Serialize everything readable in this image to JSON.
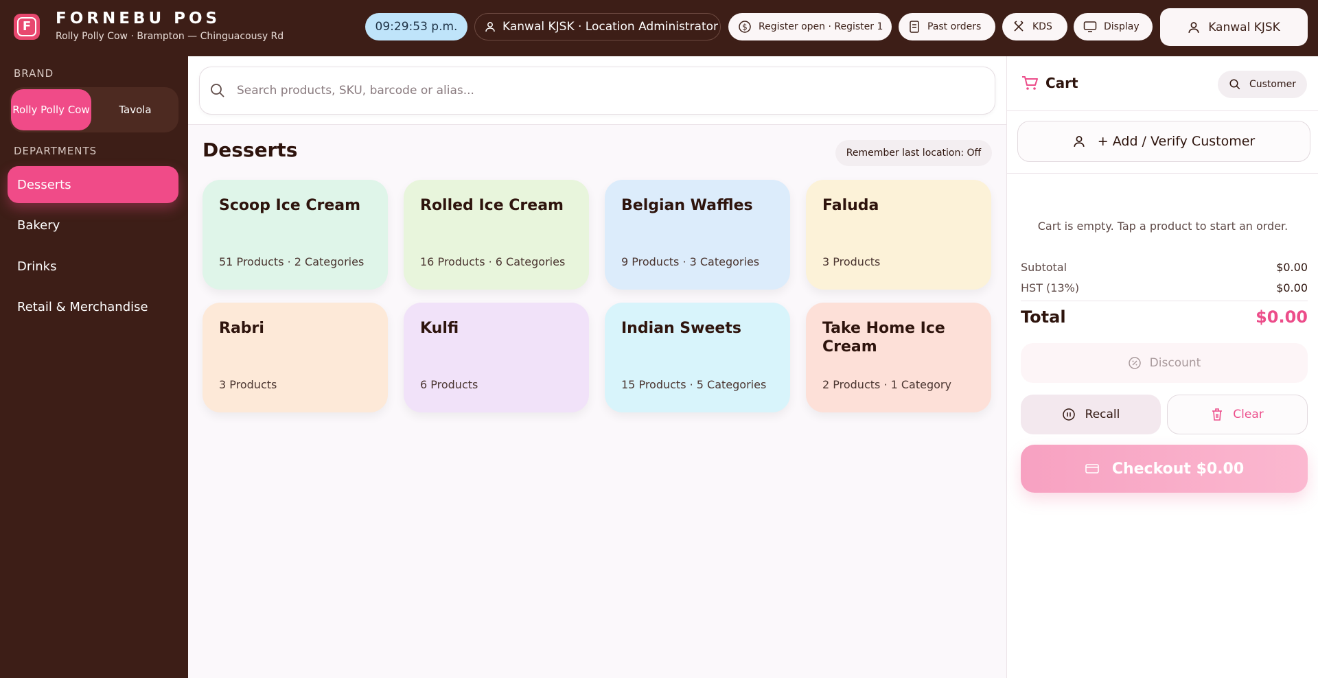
{
  "header": {
    "logo_letter": "F",
    "app_title": "FORNEBU POS",
    "location": "Rolly Polly Cow · Brampton — Chinguacousy Rd",
    "clock": "09:29:53 p.m.",
    "user_role": "Kanwal KJSK · Location Administrator",
    "register": "Register open · Register 1",
    "past_orders": "Past orders",
    "kds": "KDS",
    "display": "Display",
    "account": "Kanwal KJSK"
  },
  "sidebar": {
    "brand_label": "BRAND",
    "brands": [
      "Rolly Polly Cow",
      "Tavola"
    ],
    "departments_label": "DEPARTMENTS",
    "departments": [
      "Desserts",
      "Bakery",
      "Drinks",
      "Retail & Merchandise"
    ],
    "active_department": "Desserts"
  },
  "main": {
    "search_placeholder": "Search products, SKU, barcode or alias...",
    "section_title": "Desserts",
    "remember_label": "Remember last location: Off",
    "cards": [
      {
        "title": "Scoop Ice Cream",
        "meta": "51 Products · 2 Categories",
        "color": "#dff5e9"
      },
      {
        "title": "Rolled Ice Cream",
        "meta": "16 Products · 6 Categories",
        "color": "#e8f5dc"
      },
      {
        "title": "Belgian Waffles",
        "meta": "9 Products · 3 Categories",
        "color": "#dcecfb"
      },
      {
        "title": "Faluda",
        "meta": "3 Products",
        "color": "#fcf2d8"
      },
      {
        "title": "Rabri",
        "meta": "3 Products",
        "color": "#fde9d8"
      },
      {
        "title": "Kulfi",
        "meta": "6 Products",
        "color": "#f1e2f9"
      },
      {
        "title": "Indian Sweets",
        "meta": "15 Products · 5 Categories",
        "color": "#d8f4fb"
      },
      {
        "title": "Take Home Ice Cream",
        "meta": "2 Products · 1 Category",
        "color": "#fde0d8"
      }
    ]
  },
  "cart": {
    "title": "Cart",
    "customer_button": "Customer",
    "add_customer": "+ Add / Verify Customer",
    "empty_message": "Cart is empty. Tap a product to start an order.",
    "subtotal_label": "Subtotal",
    "subtotal": "$0.00",
    "tax_label": "HST (13%)",
    "tax": "$0.00",
    "total_label": "Total",
    "total": "$0.00",
    "discount": "Discount",
    "recall": "Recall",
    "clear": "Clear",
    "checkout": "Checkout $0.00"
  },
  "colors": {
    "accent": "#f04b88",
    "header_bg": "#3d1e17"
  }
}
